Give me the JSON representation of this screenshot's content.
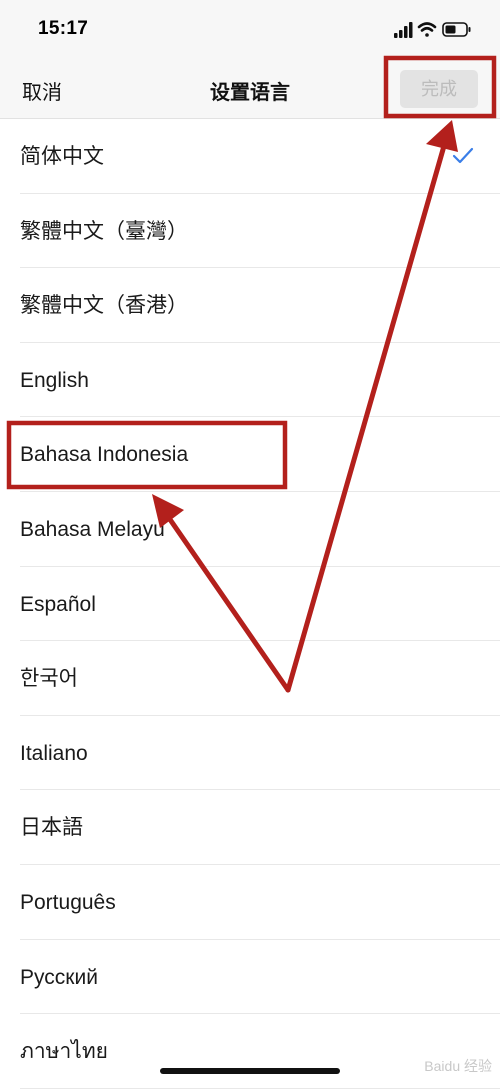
{
  "status_bar": {
    "time": "15:17",
    "icons": [
      "signal-icon",
      "wifi-icon",
      "battery-icon"
    ]
  },
  "nav": {
    "cancel_label": "取消",
    "title": "设置语言",
    "done_label": "完成"
  },
  "languages": [
    {
      "label": "简体中文",
      "selected": true
    },
    {
      "label": "繁體中文（臺灣）",
      "selected": false
    },
    {
      "label": "繁體中文（香港）",
      "selected": false
    },
    {
      "label": "English",
      "selected": false
    },
    {
      "label": "Bahasa Indonesia",
      "selected": false
    },
    {
      "label": "Bahasa Melayu",
      "selected": false
    },
    {
      "label": "Español",
      "selected": false
    },
    {
      "label": "한국어",
      "selected": false
    },
    {
      "label": "Italiano",
      "selected": false
    },
    {
      "label": "日本語",
      "selected": false
    },
    {
      "label": "Português",
      "selected": false
    },
    {
      "label": "Русский",
      "selected": false
    },
    {
      "label": "ภาษาไทย",
      "selected": false
    }
  ],
  "watermark": "Baidu 经验",
  "colors": {
    "annotation_red": "#b3201c",
    "check_blue": "#3a7ee8",
    "done_disabled_bg": "#e3e3e3",
    "done_disabled_text": "#bcbcbc"
  }
}
